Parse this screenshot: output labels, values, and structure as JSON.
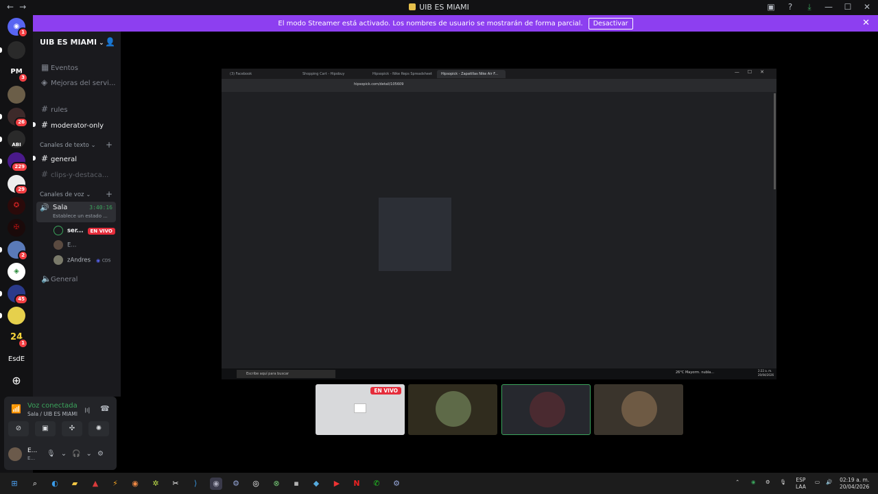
{
  "window": {
    "title": "UIB ES MIAMI",
    "nav_back": "←",
    "nav_forward": "→"
  },
  "banner": {
    "text": "El modo Streamer está activado. Los nombres de usuario se mostrarán de forma parcial.",
    "button": "Desactivar",
    "close": "✕"
  },
  "guilds": [
    {
      "label": "",
      "badge": "1"
    },
    {
      "label": "",
      "badge": ""
    },
    {
      "label": "PM",
      "badge": "3"
    },
    {
      "label": "",
      "badge": ""
    },
    {
      "label": "",
      "badge": "26"
    },
    {
      "label": "ABI",
      "badge": ""
    },
    {
      "label": "",
      "badge": "229"
    },
    {
      "label": "",
      "badge": "29"
    },
    {
      "label": "",
      "badge": ""
    },
    {
      "label": "",
      "badge": ""
    },
    {
      "label": "",
      "badge": "2"
    },
    {
      "label": "",
      "badge": ""
    },
    {
      "label": "",
      "badge": "45"
    },
    {
      "label": "",
      "badge": ""
    },
    {
      "label": "24",
      "badge": "1"
    },
    {
      "label": "EsdE",
      "badge": ""
    }
  ],
  "server": {
    "name": "UIB ES MIAMI",
    "events": "Eventos",
    "boosts": "Mejoras del servi...",
    "channels_top": [
      "rules",
      "moderator-only"
    ],
    "text_category": "Canales de texto",
    "text_channels": [
      "general",
      "clips-y-destaca..."
    ],
    "voice_category": "Canales de voz",
    "voice_active": {
      "name": "Sala",
      "time": "3:40:16",
      "status": "Establece un estado ..."
    },
    "voice_users": [
      {
        "name": "ser...",
        "live": "EN VIVO"
      },
      {
        "name": "E...",
        "live": ""
      },
      {
        "name": "zAndres",
        "live": "CDS"
      }
    ],
    "voice_other": "General"
  },
  "voice_panel": {
    "status": "Voz conectada",
    "location": "Sala / UIB ES MIAMI",
    "user": "E...",
    "user_status": "E..."
  },
  "stream": {
    "tabs": [
      "(3) Facebook",
      "Shopping Cart - Hipobuy",
      "Hipsopick - Nike Reps Spreadsheet",
      "Hipsopick - Zapatillas Nike Air F..."
    ],
    "url": "hipsopick.com/detail/105609",
    "taskbar_search": "Escribe aquí para buscar",
    "weather": "26°C  Mayorm. nubla...",
    "clock_time": "2:22 a. m.",
    "clock_date": "20/04/2026"
  },
  "tiles": {
    "live": "EN VIVO"
  },
  "taskbar": {
    "lang": "ESP",
    "lang2": "LAA",
    "time": "02:19 a. m.",
    "date": "20/04/2026"
  }
}
